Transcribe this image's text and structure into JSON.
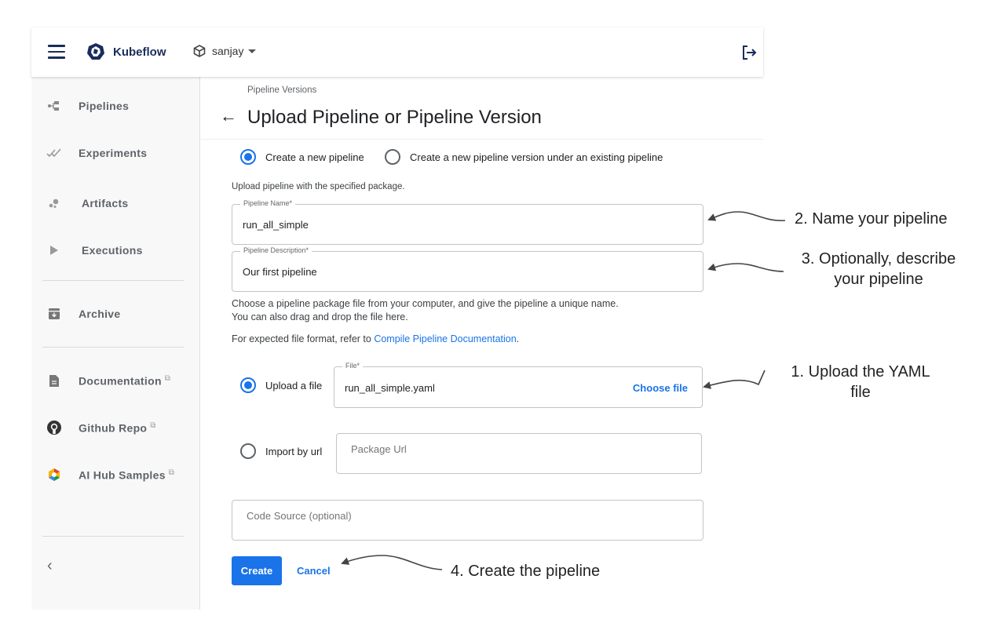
{
  "topbar": {
    "brand": "Kubeflow",
    "namespace": "sanjay"
  },
  "sidebar": {
    "items": [
      {
        "label": "Pipelines",
        "icon": "pipelines-icon"
      },
      {
        "label": "Experiments",
        "icon": "experiments-icon"
      },
      {
        "label": "Artifacts",
        "icon": "artifacts-icon"
      },
      {
        "label": "Executions",
        "icon": "executions-icon"
      },
      {
        "label": "Archive",
        "icon": "archive-icon"
      },
      {
        "label": "Documentation",
        "icon": "document-icon",
        "external": true
      },
      {
        "label": "Github Repo",
        "icon": "github-icon",
        "external": true
      },
      {
        "label": "AI Hub Samples",
        "icon": "ai-hub-icon",
        "external": true
      }
    ],
    "collapse_glyph": "‹",
    "external_glyph": "⧉"
  },
  "main": {
    "breadcrumb": "Pipeline Versions",
    "title": "Upload Pipeline or Pipeline Version",
    "mode_options": [
      {
        "label": "Create a new pipeline",
        "selected": true
      },
      {
        "label": "Create a new pipeline version under an existing pipeline",
        "selected": false
      }
    ],
    "upload_hint": "Upload pipeline with the specified package.",
    "pipeline_name": {
      "label": "Pipeline Name*",
      "value": "run_all_simple"
    },
    "pipeline_description": {
      "label": "Pipeline Description*",
      "value": "Our first pipeline"
    },
    "instructions_line1": "Choose a pipeline package file from your computer, and give the pipeline a unique name.",
    "instructions_line2": "You can also drag and drop the file here.",
    "format_prefix": "For expected file format, refer to ",
    "format_link": "Compile Pipeline Documentation",
    "format_suffix": ".",
    "source_options": [
      {
        "label": "Upload a file",
        "selected": true
      },
      {
        "label": "Import by url",
        "selected": false
      }
    ],
    "file": {
      "label": "File*",
      "value": "run_all_simple.yaml",
      "action": "Choose file"
    },
    "package_url_placeholder": "Package Url",
    "code_source_placeholder": "Code Source (optional)",
    "create_label": "Create",
    "cancel_label": "Cancel"
  },
  "annotations": {
    "step1_line1": "1. Upload the YAML",
    "step1_line2": "file",
    "step2": "2. Name your pipeline",
    "step3_line1": "3. Optionally, describe",
    "step3_line2": "your pipeline",
    "step4": "4. Create the pipeline"
  },
  "colors": {
    "accent": "#1a73e8",
    "brand": "#1a2c5c",
    "sidebar_bg": "#f8f8f9"
  }
}
